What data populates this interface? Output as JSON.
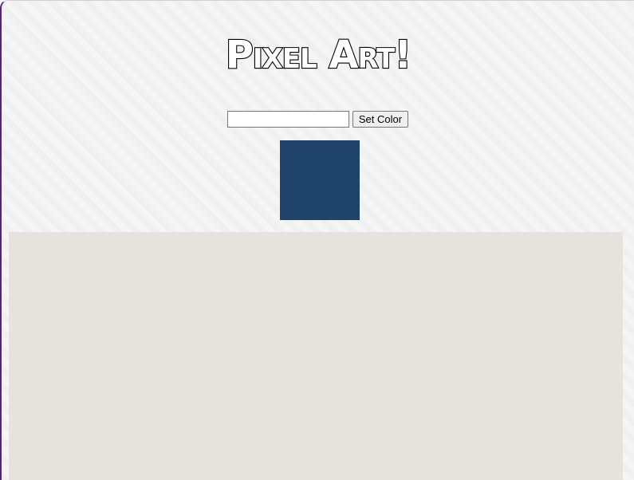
{
  "header": {
    "title": "Pixel Art!"
  },
  "controls": {
    "color_input_value": "",
    "set_color_label": "Set Color"
  },
  "preview": {
    "current_color": "#1f436b"
  },
  "canvas": {
    "background_color": "#e6e3dc"
  },
  "theme": {
    "frame_accent": "#5a1e8c"
  }
}
